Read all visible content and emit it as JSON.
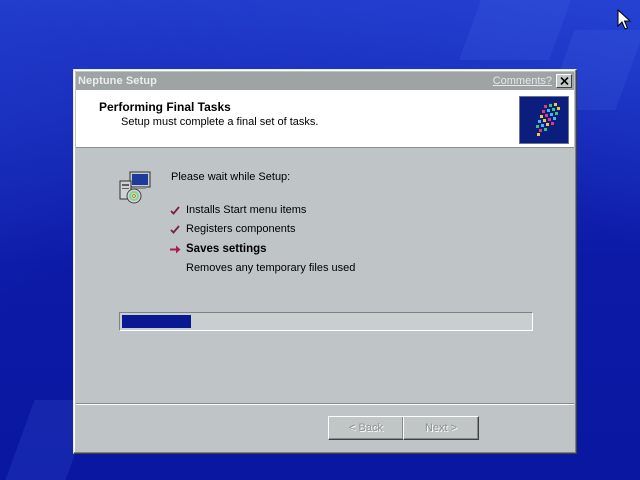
{
  "window": {
    "title": "Neptune Setup",
    "comments_link": "Comments?",
    "close_icon": "close-icon"
  },
  "header": {
    "title": "Performing Final Tasks",
    "subtitle": "Setup must complete a final set of tasks.",
    "logo_icon": "windows-logo-icon"
  },
  "main": {
    "intro": "Please wait while Setup:",
    "tasks": [
      {
        "label": "Installs Start menu items",
        "status": "done"
      },
      {
        "label": "Registers components",
        "status": "done"
      },
      {
        "label": "Saves settings",
        "status": "current"
      },
      {
        "label": "Removes any temporary files used",
        "status": "pending"
      }
    ],
    "progress": {
      "fraction": 0.17
    }
  },
  "footer": {
    "back_label": "< Back",
    "next_label": "Next >"
  },
  "colors": {
    "desktop": "#1428b4",
    "dialog": "#bfc5c6",
    "progress_fill": "#0a1894",
    "check": "#7a1f3d",
    "arrow": "#b01b4f"
  }
}
